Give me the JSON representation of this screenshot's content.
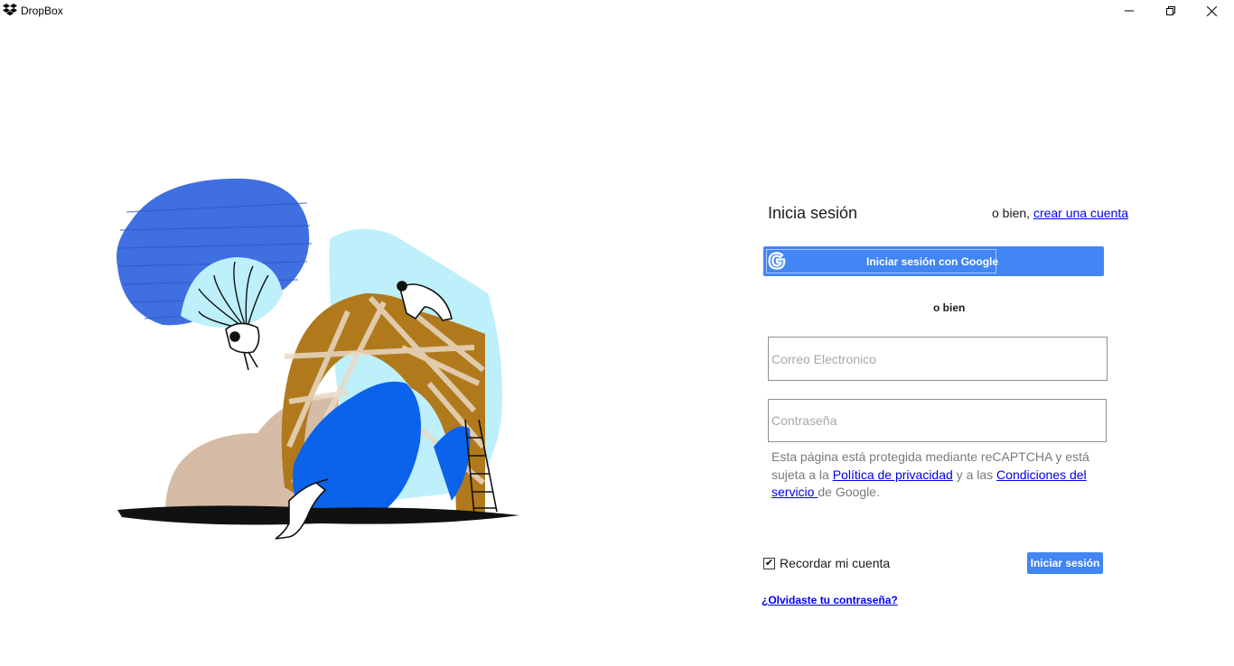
{
  "window": {
    "title": "DropBox",
    "icon": "dropbox-icon",
    "controls": [
      "minimize-icon",
      "restore-icon",
      "close-icon"
    ]
  },
  "login": {
    "heading": "Inicia sesión",
    "alt_prefix": "o bien,",
    "alt_link": "crear una cuenta",
    "google_button": "Iniciar sesión con Google",
    "or_divider": "o bien",
    "email_placeholder": "Correo Electronico",
    "password_placeholder": "Contraseña",
    "recaptcha": {
      "part1": "Esta página está protegida mediante reCAPTCHA y está sujeta a la ",
      "privacy_link": "Política de privacidad",
      "part2": " y a las ",
      "terms_link": "Condiciones del servicio ",
      "part3": "de Google."
    },
    "remember_label": "Recordar mi cuenta",
    "remember_checked": true,
    "submit_button": "Iniciar sesión",
    "forgot_link": "¿Olvidaste tu contraseña?"
  },
  "colors": {
    "accent": "#4285f4",
    "link": "#0000ee",
    "text": "#1e1919",
    "muted": "#7a7a7a"
  }
}
